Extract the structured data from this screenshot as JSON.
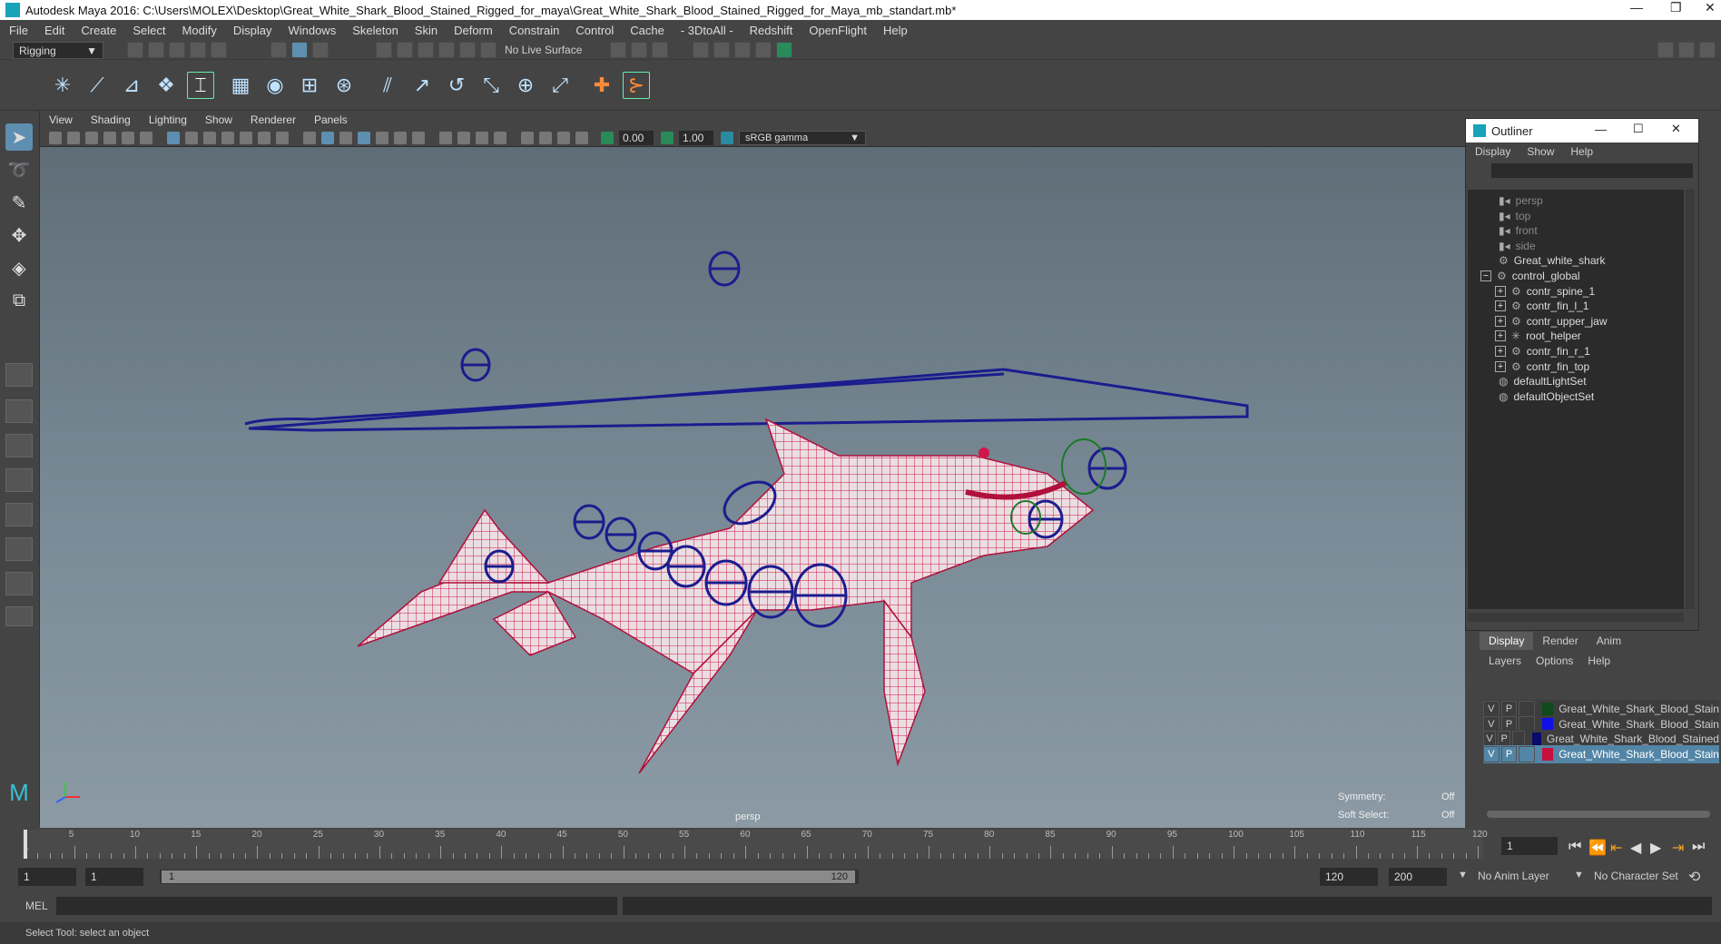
{
  "window": {
    "title": "Autodesk Maya 2016: C:\\Users\\MOLEX\\Desktop\\Great_White_Shark_Blood_Stained_Rigged_for_maya\\Great_White_Shark_Blood_Stained_Rigged_for_Maya_mb_standart.mb*",
    "controls": [
      "—",
      "❐",
      "✕"
    ]
  },
  "menubar": [
    "File",
    "Edit",
    "Create",
    "Select",
    "Modify",
    "Display",
    "Windows",
    "Skeleton",
    "Skin",
    "Deform",
    "Constrain",
    "Control",
    "Cache",
    "- 3DtoAll -",
    "Redshift",
    "OpenFlight",
    "Help"
  ],
  "statusline": {
    "mode": "Rigging",
    "live_surface": "No Live Surface"
  },
  "viewport": {
    "menu": [
      "View",
      "Shading",
      "Lighting",
      "Show",
      "Renderer",
      "Panels"
    ],
    "exposure": "0.00",
    "gamma": "1.00",
    "color_space": "sRGB gamma",
    "camera_label": "persp",
    "hud": {
      "symmetry_label": "Symmetry:",
      "symmetry_value": "Off",
      "soft_select_label": "Soft Select:",
      "soft_select_value": "Off"
    },
    "colors": {
      "mesh": "#d0174a",
      "controls": "#1c1c8e",
      "bg_top": "#5f6d77",
      "bg_bottom": "#8b9aa4"
    }
  },
  "outliner": {
    "title": "Outliner",
    "menu": [
      "Display",
      "Show",
      "Help"
    ],
    "items": [
      {
        "label": "persp",
        "icon": "camera-icon",
        "dim": true,
        "indent": 2
      },
      {
        "label": "top",
        "icon": "camera-icon",
        "dim": true,
        "indent": 2
      },
      {
        "label": "front",
        "icon": "camera-icon",
        "dim": true,
        "indent": 2
      },
      {
        "label": "side",
        "icon": "camera-icon",
        "dim": true,
        "indent": 2
      },
      {
        "label": "Great_white_shark",
        "icon": "transform-icon",
        "dim": false,
        "indent": 2
      },
      {
        "label": "control_global",
        "icon": "transform-icon",
        "dim": false,
        "indent": 1,
        "expander": "−"
      },
      {
        "label": "contr_spine_1",
        "icon": "transform-icon",
        "dim": false,
        "indent": 3,
        "expander": "+"
      },
      {
        "label": "contr_fin_l_1",
        "icon": "transform-icon",
        "dim": false,
        "indent": 3,
        "expander": "+"
      },
      {
        "label": "contr_upper_jaw",
        "icon": "transform-icon",
        "dim": false,
        "indent": 3,
        "expander": "+"
      },
      {
        "label": "root_helper",
        "icon": "locator-icon",
        "dim": false,
        "indent": 3,
        "expander": "+"
      },
      {
        "label": "contr_fin_r_1",
        "icon": "transform-icon",
        "dim": false,
        "indent": 3,
        "expander": "+"
      },
      {
        "label": "contr_fin_top",
        "icon": "transform-icon",
        "dim": false,
        "indent": 3,
        "expander": "+"
      },
      {
        "label": "defaultLightSet",
        "icon": "set-icon",
        "dim": false,
        "indent": 2
      },
      {
        "label": "defaultObjectSet",
        "icon": "set-icon",
        "dim": false,
        "indent": 2
      }
    ]
  },
  "layer_editor": {
    "tabs": [
      "Display",
      "Render",
      "Anim"
    ],
    "menu": [
      "Layers",
      "Options",
      "Help"
    ],
    "layers": [
      {
        "v": "V",
        "p": "P",
        "color": "#0f4a1c",
        "name": "Great_White_Shark_Blood_Stain",
        "selected": false
      },
      {
        "v": "V",
        "p": "P",
        "color": "#1010e8",
        "name": "Great_White_Shark_Blood_Stain",
        "selected": false
      },
      {
        "v": "V",
        "p": "P",
        "color": "#0a0a6a",
        "name": "Great_White_Shark_Blood_Stained",
        "selected": false
      },
      {
        "v": "V",
        "p": "P",
        "color": "#c8103e",
        "name": "Great_White_Shark_Blood_Stain",
        "selected": true
      }
    ]
  },
  "timeline": {
    "ticks": [
      "5",
      "10",
      "15",
      "20",
      "25",
      "30",
      "35",
      "40",
      "45",
      "50",
      "55",
      "60",
      "65",
      "70",
      "75",
      "80",
      "85",
      "90",
      "95",
      "100",
      "105",
      "110",
      "115",
      "120"
    ],
    "start_tick": "1",
    "current_frame": "1"
  },
  "range": {
    "start": "1",
    "playback_start": "1",
    "slider_start": "1",
    "slider_end": "120",
    "playback_end": "120",
    "end": "200",
    "anim_layer": "No Anim Layer",
    "character_set": "No Character Set"
  },
  "cmdline": {
    "label": "MEL"
  },
  "helpline": {
    "text": "Select Tool: select an object"
  }
}
